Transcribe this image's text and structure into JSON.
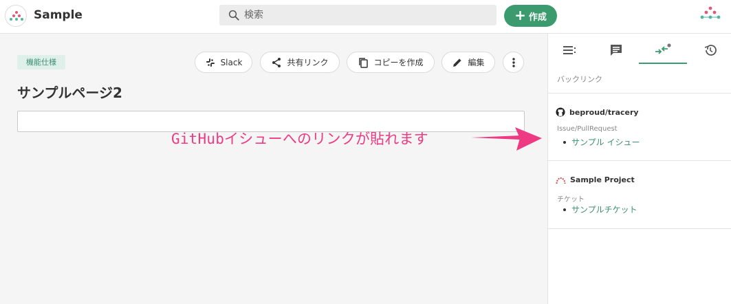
{
  "header": {
    "app_title": "Sample",
    "search_placeholder": "検索",
    "create_label": "作成"
  },
  "page": {
    "tag": "機能仕様",
    "title": "サンプルページ2",
    "actions": {
      "slack": "Slack",
      "share": "共有リンク",
      "copy": "コピーを作成",
      "edit": "編集"
    }
  },
  "annotation": "GitHubイシューへのリンクが貼れます",
  "panel": {
    "section_label": "バックリンク",
    "groups": [
      {
        "source": "beproud/tracery",
        "type_label": "Issue/PullRequest",
        "item": "サンプル イシュー"
      },
      {
        "source": "Sample Project",
        "type_label": "チケット",
        "item": "サンプルチケット"
      }
    ]
  },
  "colors": {
    "accent": "#3c9b6e",
    "annotation": "#ee3a82"
  }
}
